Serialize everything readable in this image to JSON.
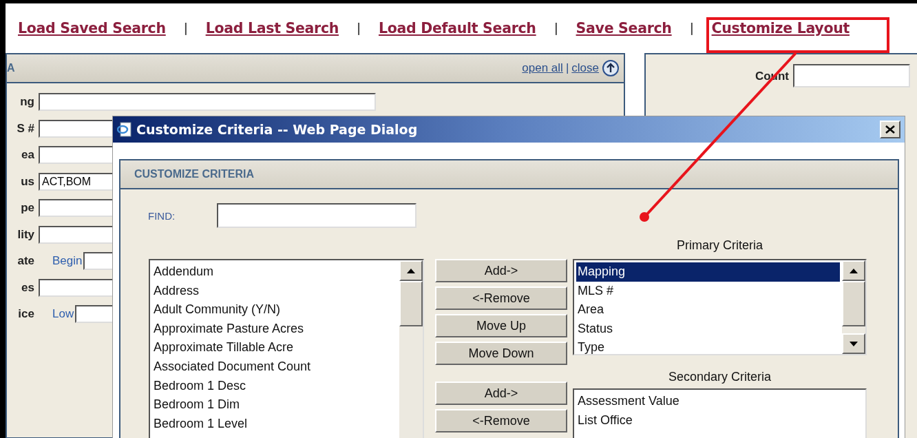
{
  "top_links": [
    {
      "kind": "link",
      "text": "Load Saved Search"
    },
    {
      "kind": "separator",
      "text": "|"
    },
    {
      "kind": "link",
      "text": "Load Last Search"
    },
    {
      "kind": "separator",
      "text": "|"
    },
    {
      "kind": "link",
      "text": "Load Default Search"
    },
    {
      "kind": "separator",
      "text": "|"
    },
    {
      "kind": "link",
      "text": "Save Search"
    },
    {
      "kind": "separator",
      "text": "|"
    },
    {
      "kind": "link",
      "text": "Customize Layout"
    }
  ],
  "left_panel": {
    "title": "A",
    "open_all": "open all",
    "separator": "|",
    "close": "close",
    "fields": [
      {
        "label": "ng"
      },
      {
        "label": "S #"
      },
      {
        "label": "ea"
      },
      {
        "label": "us",
        "value": "ACT,BOM"
      },
      {
        "label": "pe"
      },
      {
        "label": "lity"
      },
      {
        "label": "ate",
        "sublabel": "Begin"
      },
      {
        "label": "es"
      },
      {
        "label": "ice",
        "sublabel": "Low"
      }
    ]
  },
  "right_panel": {
    "count_label": "Count"
  },
  "dialog": {
    "title": "Customize Criteria -- Web Page Dialog",
    "header": "CUSTOMIZE CRITERIA",
    "find_label": "FIND:",
    "available": [
      {
        "text": "Addendum",
        "selected": false
      },
      {
        "text": "Address",
        "selected": false
      },
      {
        "text": "Adult Community (Y/N)",
        "selected": false
      },
      {
        "text": "Approximate Pasture Acres",
        "selected": false
      },
      {
        "text": "Approximate Tillable Acre",
        "selected": false
      },
      {
        "text": "Associated Document Count",
        "selected": false
      },
      {
        "text": "Bedroom 1 Desc",
        "selected": false
      },
      {
        "text": "Bedroom 1 Dim",
        "selected": false
      },
      {
        "text": "Bedroom 1 Level",
        "selected": false
      }
    ],
    "primary_buttons": [
      "Add->",
      "<-Remove",
      "Move Up",
      "Move Down"
    ],
    "secondary_buttons": [
      "Add->",
      "<-Remove"
    ],
    "primary_label": "Primary Criteria",
    "primary": [
      {
        "text": "Mapping",
        "selected": true
      },
      {
        "text": "MLS #",
        "selected": false
      },
      {
        "text": "Area",
        "selected": false
      },
      {
        "text": "Status",
        "selected": false
      },
      {
        "text": "Type",
        "selected": false
      }
    ],
    "secondary_label": "Secondary Criteria",
    "secondary": [
      {
        "text": "Assessment Value",
        "selected": false
      },
      {
        "text": "List Office",
        "selected": false
      }
    ]
  }
}
